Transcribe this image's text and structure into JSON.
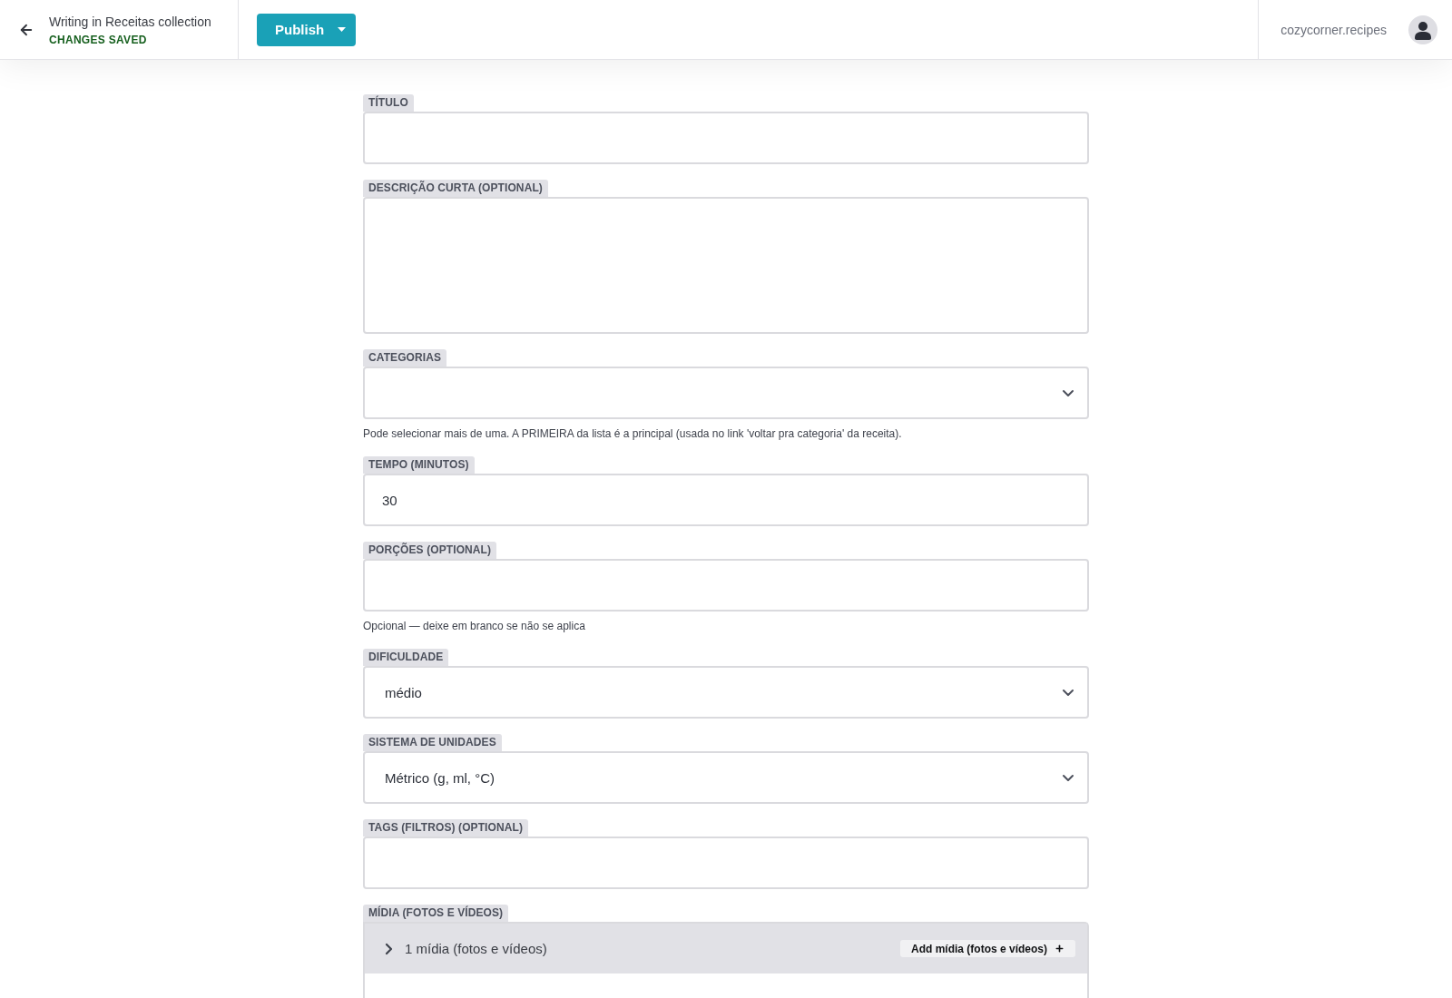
{
  "header": {
    "title": "Writing in Receitas collection",
    "status": "CHANGES SAVED",
    "publish_button": "Publish",
    "site": "cozycorner.recipes"
  },
  "fields": [
    {
      "kind": "text",
      "label": "TÍTULO"
    },
    {
      "kind": "textarea",
      "label": "DESCRIÇÃO CURTA (OPTIONAL)"
    },
    {
      "kind": "select",
      "label": "CATEGORIAS",
      "hint": "Pode selecionar mais de uma. A PRIMEIRA da lista é a principal (usada no link 'voltar pra categoria' da receita)."
    },
    {
      "kind": "text",
      "label": "TEMPO (MINUTOS)",
      "value": "30"
    },
    {
      "kind": "text",
      "label": "PORÇÕES (OPTIONAL)",
      "hint": "Opcional — deixe em branco se não se aplica"
    },
    {
      "kind": "select",
      "label": "DIFICULDADE",
      "value": "médio"
    },
    {
      "kind": "select",
      "label": "SISTEMA DE UNIDADES",
      "value": "Métrico (g, ml, °C)"
    },
    {
      "kind": "text",
      "label": "TAGS (FILTROS) (OPTIONAL)"
    },
    {
      "kind": "media",
      "label": "MÍDIA (FOTOS E VÍDEOS)",
      "summary": "1 mídia (fotos e vídeos)",
      "expanded": false,
      "add_button": "Add mídia (fotos e vídeos)"
    }
  ]
}
